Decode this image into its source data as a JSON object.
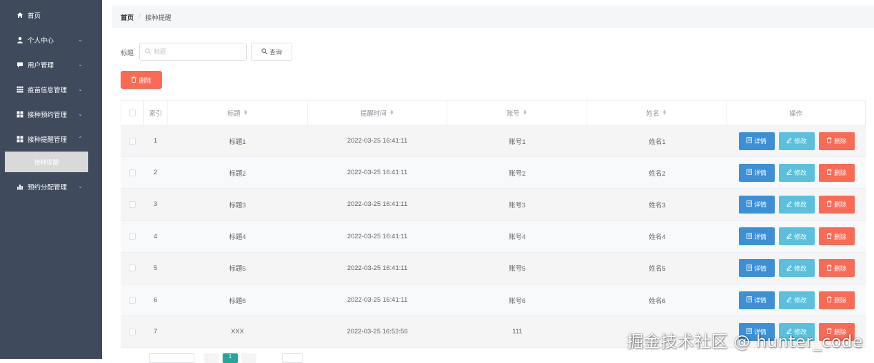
{
  "sidebar": {
    "items": [
      {
        "label": "首页",
        "icon": "home-icon",
        "has_chevron": false
      },
      {
        "label": "个人中心",
        "icon": "user-icon",
        "has_chevron": true
      },
      {
        "label": "用户管理",
        "icon": "chat-icon",
        "has_chevron": true
      },
      {
        "label": "疫苗信息管理",
        "icon": "grid-icon",
        "has_chevron": true
      },
      {
        "label": "接种预约管理",
        "icon": "apps-icon",
        "has_chevron": true
      },
      {
        "label": "接种提醒管理",
        "icon": "apps-icon",
        "has_chevron": true
      },
      {
        "label": "预约分配管理",
        "icon": "bar-chart-icon",
        "has_chevron": true
      }
    ],
    "active_sub_item": "接种提醒"
  },
  "breadcrumb": {
    "home": "首页",
    "separator": "/",
    "current": "接种提醒"
  },
  "search": {
    "label": "标题",
    "placeholder": "标题",
    "query_label": "查询"
  },
  "toolbar": {
    "delete_label": "删除"
  },
  "table": {
    "columns": [
      "索引",
      "标题",
      "提醒时间",
      "账号",
      "姓名",
      "操作"
    ],
    "sortable": [
      "标题",
      "提醒时间",
      "账号",
      "姓名"
    ],
    "actions": {
      "detail": "详情",
      "edit": "修改",
      "delete": "删除"
    },
    "rows": [
      {
        "index": "1",
        "title": "标题1",
        "time": "2022-03-25 16:41:11",
        "account": "账号1",
        "name": "姓名1"
      },
      {
        "index": "2",
        "title": "标题2",
        "time": "2022-03-25 16:41:11",
        "account": "账号2",
        "name": "姓名2"
      },
      {
        "index": "3",
        "title": "标题3",
        "time": "2022-03-25 16:41:11",
        "account": "账号3",
        "name": "姓名3"
      },
      {
        "index": "4",
        "title": "标题4",
        "time": "2022-03-25 16:41:11",
        "account": "账号4",
        "name": "姓名4"
      },
      {
        "index": "5",
        "title": "标题5",
        "time": "2022-03-25 16:41:11",
        "account": "账号5",
        "name": "姓名5"
      },
      {
        "index": "6",
        "title": "标题6",
        "time": "2022-03-25 16:41:11",
        "account": "账号6",
        "name": "姓名6"
      },
      {
        "index": "7",
        "title": "XXX",
        "time": "2022-03-25 16:53:56",
        "account": "111",
        "name": ""
      }
    ]
  },
  "pager": {
    "current_page": "1"
  },
  "watermark": "掘金技术社区 @ hunter_code",
  "colors": {
    "sidebar_bg": "#3f4a5c",
    "detail_btn": "#3d8fd6",
    "edit_btn": "#5bc0de",
    "delete_btn": "#fb6a54",
    "pager_active": "#26a69a"
  }
}
